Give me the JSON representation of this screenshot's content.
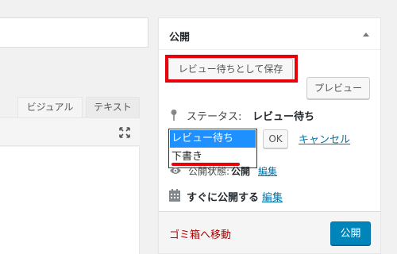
{
  "editor": {
    "tabs": [
      {
        "label": "ビジュアル"
      },
      {
        "label": "テキスト"
      }
    ],
    "fullscreen_icon": "expand-icon"
  },
  "publish": {
    "title": "公開",
    "save_button": "レビュー待ちとして保存",
    "preview_button": "プレビュー",
    "status_label": "ステータス:",
    "status_value": "レビュー待ち",
    "status_options": [
      "レビュー待ち",
      "下書き"
    ],
    "ok_button": "OK",
    "cancel_link": "キャンセル",
    "visibility_label": "公開状態:",
    "visibility_value": "公開",
    "visibility_edit": "編集",
    "schedule_label": "すぐに公開する",
    "schedule_edit": "編集",
    "trash_link": "ゴミ箱へ移動",
    "publish_button": "公開"
  },
  "colors": {
    "accent": "#0085ba",
    "link": "#0073aa",
    "highlight": "#e8000b",
    "trash": "#aa0000",
    "selected_option": "#1e90ff"
  }
}
